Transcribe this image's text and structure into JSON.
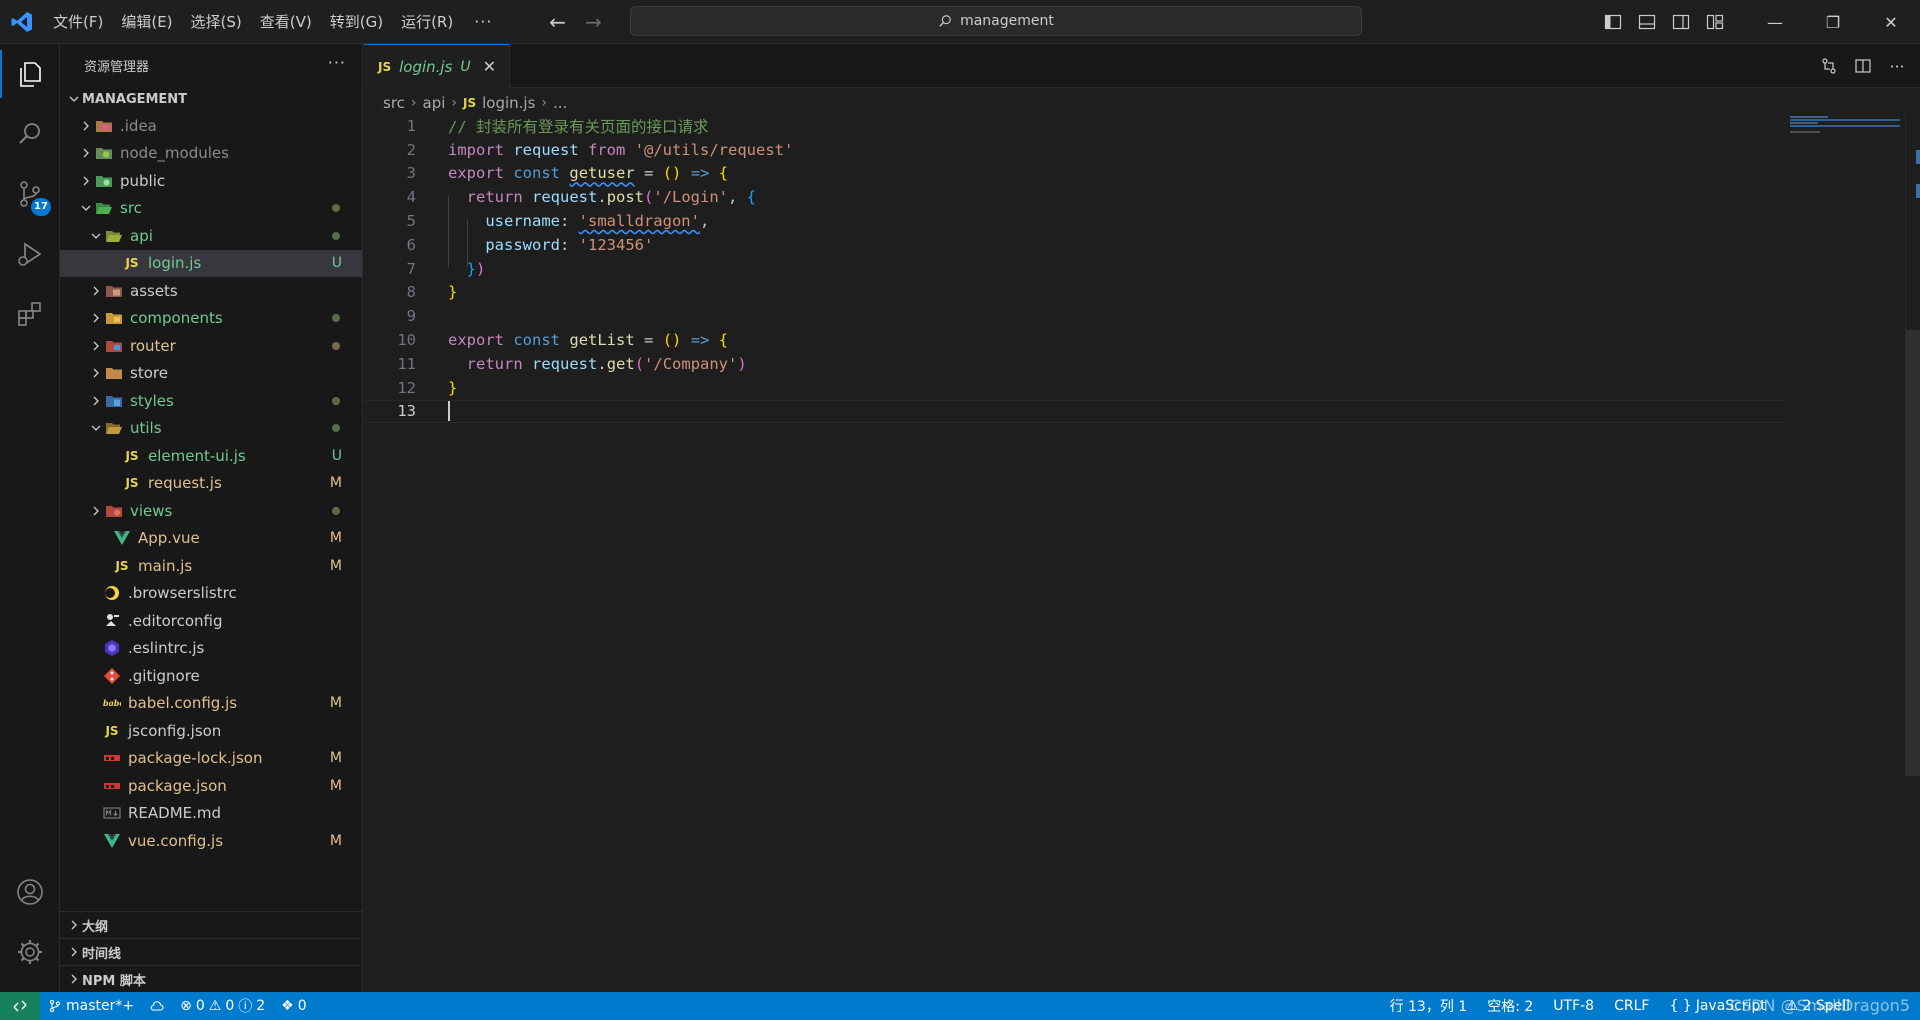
{
  "titlebar": {
    "menus": [
      "文件(F)",
      "编辑(E)",
      "选择(S)",
      "查看(V)",
      "转到(G)",
      "运行(R)"
    ],
    "more": "···",
    "search_text": "management"
  },
  "activity": {
    "scm_badge": "17"
  },
  "explorer": {
    "header": "资源管理器",
    "more": "···",
    "root": "MANAGEMENT",
    "items": [
      {
        "name": ".idea",
        "deco": ""
      },
      {
        "name": "node_modules",
        "deco": ""
      },
      {
        "name": "public",
        "deco": ""
      },
      {
        "name": "src",
        "deco": ""
      },
      {
        "name": "api",
        "deco": ""
      },
      {
        "name": "login.js",
        "deco": "U"
      },
      {
        "name": "assets",
        "deco": ""
      },
      {
        "name": "components",
        "deco": ""
      },
      {
        "name": "router",
        "deco": ""
      },
      {
        "name": "store",
        "deco": ""
      },
      {
        "name": "styles",
        "deco": ""
      },
      {
        "name": "utils",
        "deco": ""
      },
      {
        "name": "element-ui.js",
        "deco": "U"
      },
      {
        "name": "request.js",
        "deco": "M"
      },
      {
        "name": "views",
        "deco": ""
      },
      {
        "name": "App.vue",
        "deco": "M"
      },
      {
        "name": "main.js",
        "deco": "M"
      },
      {
        "name": ".browserslistrc",
        "deco": ""
      },
      {
        "name": ".editorconfig",
        "deco": ""
      },
      {
        "name": ".eslintrc.js",
        "deco": ""
      },
      {
        "name": ".gitignore",
        "deco": ""
      },
      {
        "name": "babel.config.js",
        "deco": "M"
      },
      {
        "name": "jsconfig.json",
        "deco": ""
      },
      {
        "name": "package-lock.json",
        "deco": "M"
      },
      {
        "name": "package.json",
        "deco": "M"
      },
      {
        "name": "README.md",
        "deco": ""
      },
      {
        "name": "vue.config.js",
        "deco": "M"
      }
    ],
    "sections": [
      "大纲",
      "时间线",
      "NPM 脚本"
    ]
  },
  "editor": {
    "tab": {
      "icon": "JS",
      "name": "login.js",
      "status": "U",
      "close": "✕"
    },
    "breadcrumb": [
      "src",
      "api",
      "login.js",
      "..."
    ],
    "line_numbers": [
      "1",
      "2",
      "3",
      "4",
      "5",
      "6",
      "7",
      "8",
      "9",
      "10",
      "11",
      "12",
      "13"
    ],
    "code": {
      "l1": "// 封装所有登录有关页面的接口请求",
      "l2_kw": "import",
      "l2_var": "request",
      "l2_from": "from",
      "l2_str": "'@/utils/request'",
      "l3_export": "export",
      "l3_const": "const",
      "l3_name": "getuser",
      "l4_return": "return",
      "l4_obj": "request",
      "l4_fn": "post",
      "l4_str": "'/Login'",
      "l5_key": "username",
      "l5_val": "'smalldragon'",
      "l6_key": "password",
      "l6_val": "'123456'",
      "l10_export": "export",
      "l10_const": "const",
      "l10_name": "getList",
      "l11_return": "return",
      "l11_obj": "request",
      "l11_fn": "get",
      "l11_str": "'/Company'"
    }
  },
  "status": {
    "branch": "master*+",
    "errors": "0",
    "warnings": "0",
    "infos": "2",
    "ports": "0",
    "position": "行 13，列 1",
    "spaces": "空格: 2",
    "encoding": "UTF-8",
    "eol": "CRLF",
    "language": "JavaScript",
    "spell": "2 Spell",
    "watermark": "CSDN @SmallDragon5"
  },
  "colors": {
    "accent": "#0078d4",
    "statusbar": "#007acc",
    "untracked": "#73c991",
    "modified": "#e2c08d"
  }
}
